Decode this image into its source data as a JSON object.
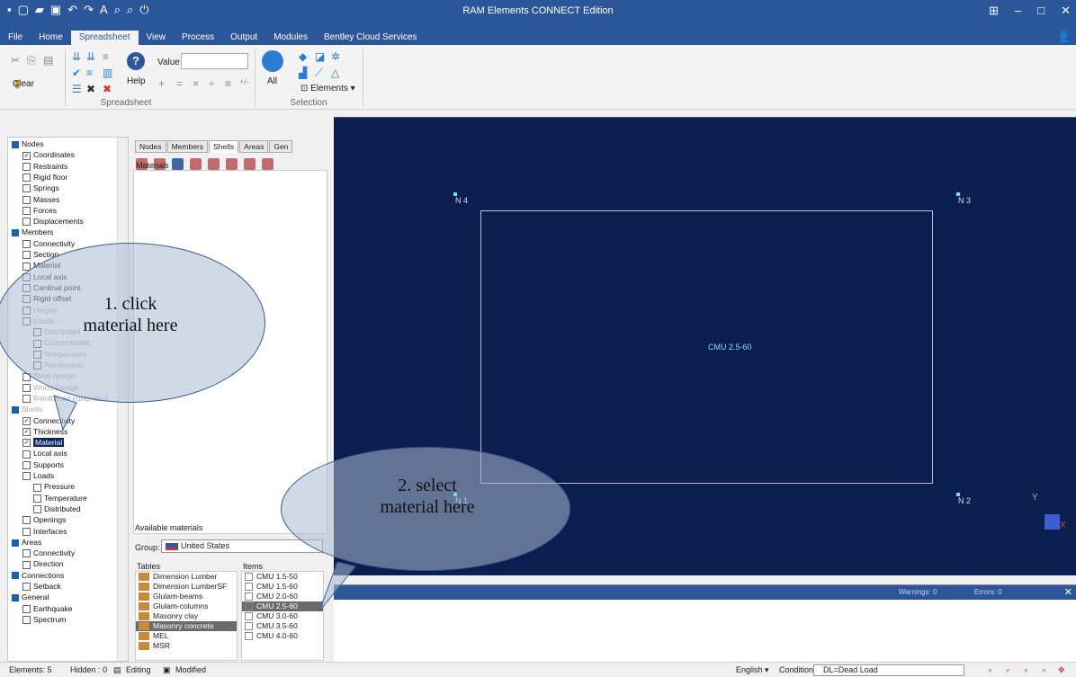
{
  "window": {
    "title": "RAM Elements CONNECT Edition"
  },
  "menu_tabs": [
    "File",
    "Home",
    "Spreadsheet",
    "View",
    "Process",
    "Output",
    "Modules",
    "Bentley Cloud Services"
  ],
  "active_tab": "Spreadsheet",
  "ribbon": {
    "clear_label": "Clear",
    "help_label": "Help",
    "value_label": "Value",
    "value_field": "",
    "all_label": "All",
    "elements_label": "Elements",
    "group_spreadsheet": "Spreadsheet",
    "group_selection": "Selection"
  },
  "tree": [
    {
      "label": "Nodes",
      "level": 0,
      "type": "group"
    },
    {
      "label": "Coordinates",
      "level": 1,
      "checked": true
    },
    {
      "label": "Restraints",
      "level": 1
    },
    {
      "label": "Rigid floor",
      "level": 1
    },
    {
      "label": "Springs",
      "level": 1
    },
    {
      "label": "Masses",
      "level": 1
    },
    {
      "label": "Forces",
      "level": 1
    },
    {
      "label": "Displacements",
      "level": 1
    },
    {
      "label": "Members",
      "level": 0,
      "type": "group"
    },
    {
      "label": "Connectivity",
      "level": 1
    },
    {
      "label": "Section",
      "level": 1
    },
    {
      "label": "Material",
      "level": 1
    },
    {
      "label": "Local axis",
      "level": 1
    },
    {
      "label": "Cardinal point",
      "level": 1
    },
    {
      "label": "Rigid offset",
      "level": 1
    },
    {
      "label": "Hinges",
      "level": 1,
      "dim": true
    },
    {
      "label": "Loads",
      "level": 1,
      "dim": true
    },
    {
      "label": "Distributed",
      "level": 2,
      "dim": true
    },
    {
      "label": "Concentrated",
      "level": 2,
      "dim": true
    },
    {
      "label": "Temperature",
      "level": 2,
      "dim": true
    },
    {
      "label": "Pre-tension",
      "level": 2,
      "dim": true
    },
    {
      "label": "Steel design",
      "level": 1,
      "dim": true
    },
    {
      "label": "Wood Design",
      "level": 1,
      "dim": true
    },
    {
      "label": "Reinforced concrete d",
      "level": 1,
      "dim": true
    },
    {
      "label": "Shells",
      "level": 0,
      "type": "group",
      "dim": true
    },
    {
      "label": "Connectivity",
      "level": 1,
      "checked": true
    },
    {
      "label": "Thickness",
      "level": 1,
      "checked": true
    },
    {
      "label": "Material",
      "level": 1,
      "checked": true,
      "selected": true
    },
    {
      "label": "Local axis",
      "level": 1
    },
    {
      "label": "Supports",
      "level": 1
    },
    {
      "label": "Loads",
      "level": 1
    },
    {
      "label": "Pressure",
      "level": 2
    },
    {
      "label": "Temperature",
      "level": 2
    },
    {
      "label": "Distributed",
      "level": 2
    },
    {
      "label": "Openings",
      "level": 1
    },
    {
      "label": "Interfaces",
      "level": 1
    },
    {
      "label": "Areas",
      "level": 0,
      "type": "group"
    },
    {
      "label": "Connectivity",
      "level": 1
    },
    {
      "label": "Direction",
      "level": 1
    },
    {
      "label": "Connections",
      "level": 0,
      "type": "group"
    },
    {
      "label": "Setback",
      "level": 1
    },
    {
      "label": "General",
      "level": 0,
      "type": "group"
    },
    {
      "label": "Earthquake",
      "level": 1
    },
    {
      "label": "Spectrum",
      "level": 1
    }
  ],
  "panel": {
    "tabs": [
      "Nodes",
      "Members",
      "Shells",
      "Areas",
      "Gen"
    ],
    "active_tab": "Shells",
    "materials_label": "Materials",
    "available_label": "Available materials",
    "group_label": "Group:",
    "group_value": "United States",
    "tables_label": "Tables",
    "items_label": "Items",
    "tables": [
      "Dimension Lumber",
      "Dimension LumberSF",
      "Glulam-beams",
      "Glulam-columns",
      "Masonry clay",
      "Masonry concrete",
      "MEL",
      "MSR"
    ],
    "selected_table": "Masonry concrete",
    "items": [
      "CMU 1.5-50",
      "CMU 1.5-60",
      "CMU 2.0-60",
      "CMU 2.5-60",
      "CMU 3.0-60",
      "CMU 3.5-60",
      "CMU 4.0-60"
    ],
    "selected_item": "CMU 2.5-60"
  },
  "canvas": {
    "nodes": [
      "N 4",
      "N 3",
      "N 1",
      "N 2"
    ],
    "shell_label": "CMU 2.5-60",
    "axis_y": "Y",
    "axis_x": "X"
  },
  "output": {
    "warnings": "Warnings: 0",
    "errors": "Errors: 0"
  },
  "status": {
    "elements": "Elements: 5",
    "hidden": "Hidden : 0",
    "editing": "Editing",
    "modified": "Modified",
    "language": "English",
    "conditions_label": "Conditions:",
    "conditions_value": "DL=Dead Load"
  },
  "callouts": {
    "c1_line1": "1. click",
    "c1_line2": "material here",
    "c2_line1": "2. select",
    "c2_line2": "material here"
  }
}
